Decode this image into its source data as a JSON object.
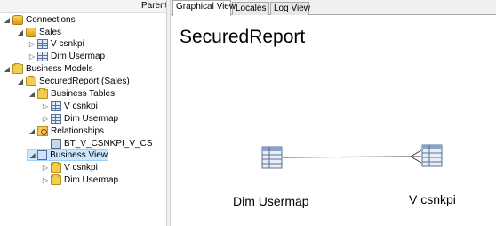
{
  "tree": {
    "column_header": "Parent (",
    "items": [
      {
        "label": "Connections",
        "icon": "database-icon",
        "expand": "expanded"
      },
      {
        "label": "Sales",
        "icon": "database-icon",
        "expand": "expanded"
      },
      {
        "label": "V csnkpi",
        "icon": "table-icon",
        "expand": "collapsed"
      },
      {
        "label": "Dim Usermap",
        "icon": "table-icon",
        "expand": "collapsed"
      },
      {
        "label": "Business Models",
        "icon": "business-models-icon",
        "expand": "expanded"
      },
      {
        "label": "SecuredReport (Sales)",
        "icon": "model-icon",
        "expand": "expanded"
      },
      {
        "label": "Business Tables",
        "icon": "business-tables-icon",
        "expand": "expanded"
      },
      {
        "label": "V csnkpi",
        "icon": "table-icon",
        "expand": "collapsed"
      },
      {
        "label": "Dim Usermap",
        "icon": "table-icon",
        "expand": "collapsed"
      },
      {
        "label": "Relationships",
        "icon": "relationships-icon",
        "expand": "expanded"
      },
      {
        "label": "BT_V_CSNKPI_V_CS",
        "icon": "relationship-icon",
        "expand": "none"
      },
      {
        "label": "Business View",
        "icon": "business-view-icon",
        "expand": "expanded"
      },
      {
        "label": "V csnkpi",
        "icon": "folder-icon",
        "expand": "collapsed"
      },
      {
        "label": "Dim Usermap",
        "icon": "folder-icon",
        "expand": "collapsed"
      }
    ]
  },
  "tabs": [
    {
      "label": "Graphical View",
      "active": true
    },
    {
      "label": "Locales",
      "active": false
    },
    {
      "label": "Log View",
      "active": false
    }
  ],
  "diagram": {
    "title": "SecuredReport",
    "nodes": [
      {
        "label": "Dim Usermap"
      },
      {
        "label": "V csnkpi"
      }
    ]
  }
}
